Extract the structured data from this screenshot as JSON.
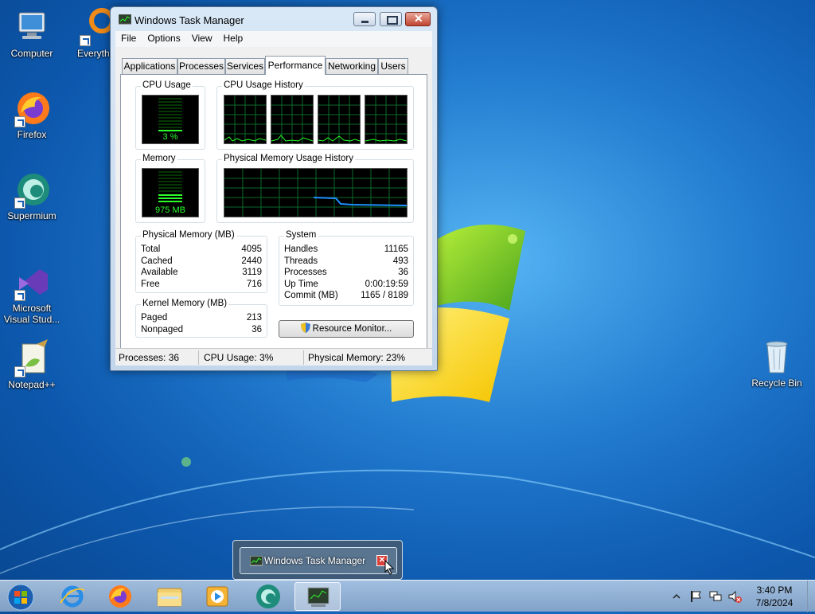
{
  "desktop": {
    "icons": [
      {
        "label": "Computer",
        "icon": "computer-icon"
      },
      {
        "label": "Everythin",
        "icon": "everything-search-icon"
      },
      {
        "label": "Firefox",
        "icon": "firefox-icon"
      },
      {
        "label": "Supermium",
        "icon": "supermium-icon"
      },
      {
        "label": "Microsoft Visual Stud...",
        "icon": "visual-studio-icon"
      },
      {
        "label": "Notepad++",
        "icon": "notepadpp-icon"
      },
      {
        "label": "Recycle Bin",
        "icon": "recycle-bin-icon"
      }
    ]
  },
  "window": {
    "title": "Windows Task Manager",
    "menu": [
      "File",
      "Options",
      "View",
      "Help"
    ],
    "tabs": [
      "Applications",
      "Processes",
      "Services",
      "Performance",
      "Networking",
      "Users"
    ],
    "active_tab": "Performance",
    "cpu_usage": {
      "label": "CPU Usage",
      "value_text": "3 %",
      "percent": 3
    },
    "cpu_history": {
      "label": "CPU Usage History"
    },
    "memory": {
      "label": "Memory",
      "value_text": "975 MB"
    },
    "memory_history": {
      "label": "Physical Memory Usage History"
    },
    "physical_memory": {
      "label": "Physical Memory (MB)",
      "rows": [
        {
          "k": "Total",
          "v": "4095"
        },
        {
          "k": "Cached",
          "v": "2440"
        },
        {
          "k": "Available",
          "v": "3119"
        },
        {
          "k": "Free",
          "v": "716"
        }
      ]
    },
    "kernel_memory": {
      "label": "Kernel Memory (MB)",
      "rows": [
        {
          "k": "Paged",
          "v": "213"
        },
        {
          "k": "Nonpaged",
          "v": "36"
        }
      ]
    },
    "system": {
      "label": "System",
      "rows": [
        {
          "k": "Handles",
          "v": "11165"
        },
        {
          "k": "Threads",
          "v": "493"
        },
        {
          "k": "Processes",
          "v": "36"
        },
        {
          "k": "Up Time",
          "v": "0:00:19:59"
        },
        {
          "k": "Commit (MB)",
          "v": "1165 / 8189"
        }
      ]
    },
    "resource_monitor_label": "Resource Monitor...",
    "status": {
      "processes": "Processes: 36",
      "cpu": "CPU Usage: 3%",
      "memory": "Physical Memory: 23%"
    }
  },
  "popup": {
    "title": "Windows Task Manager"
  },
  "taskbar": {
    "apps": [
      "start-orb-icon",
      "internet-explorer-icon",
      "firefox-icon",
      "explorer-folder-icon",
      "media-player-icon",
      "supermium-icon",
      "task-manager-icon"
    ],
    "clock_time": "3:40 PM",
    "clock_date": "7/8/2024"
  },
  "colors": {
    "graph_green": "#2aff2a",
    "memory_line": "#1e90ff",
    "close_red": "#c2442f"
  }
}
